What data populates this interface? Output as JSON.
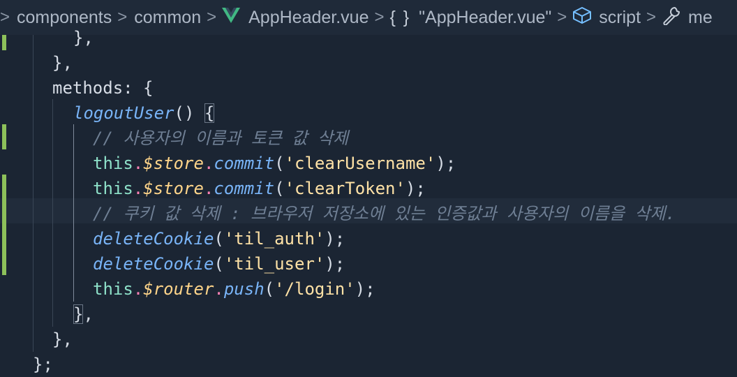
{
  "breadcrumb": {
    "items": [
      "components",
      "common",
      "AppHeader.vue",
      "\"AppHeader.vue\"",
      "script",
      "me"
    ],
    "separator": ">",
    "brace_glyph": "{ }",
    "icons": [
      "chevron-right-icon",
      "vue-logo-icon",
      "braces-icon",
      "cube-icon",
      "wrench-icon"
    ]
  },
  "code": {
    "l0_a": "},",
    "l1_a": "},",
    "l2_a": "methods: {",
    "l3_fn": "logoutUser",
    "l3_b": "() ",
    "l3_c": "{",
    "l4_cm": "// 사용자의 이름과 토큰 값 삭제",
    "l5_this": "this",
    "l5_dot1": ".",
    "l5_prop": "$store",
    "l5_dot2": ".",
    "l5_fn": "commit",
    "l5_open": "(",
    "l5_str": "'clearUsername'",
    "l5_close": ");",
    "l6_this": "this",
    "l6_dot1": ".",
    "l6_prop": "$store",
    "l6_dot2": ".",
    "l6_fn": "commit",
    "l6_open": "(",
    "l6_str": "'clearToken'",
    "l6_close": ");",
    "l7_cm": "// 쿠키 값 삭제 : 브라우저 저장소에 있는 인증값과 사용자의 이름을 삭제.",
    "l8_fn": "deleteCookie",
    "l8_open": "(",
    "l8_str": "'til_auth'",
    "l8_close": ");",
    "l9_fn": "deleteCookie",
    "l9_open": "(",
    "l9_str": "'til_user'",
    "l9_close": ");",
    "l10_this": "this",
    "l10_dot1": ".",
    "l10_prop": "$router",
    "l10_dot2": ".",
    "l10_fn": "push",
    "l10_open": "(",
    "l10_str": "'/login'",
    "l10_close": ");",
    "l11_brace": "}",
    "l11_comma": ",",
    "l12_a": "},",
    "l13_a": "};"
  },
  "colors": {
    "background": "#1b2533",
    "git_added": "#8dc15a",
    "keyword_this": "#8ee1c9",
    "property": "#ffd58a",
    "function": "#79b4f7",
    "string": "#ffe2a6",
    "comment": "#6f7f94",
    "operator_dot": "#ff82b6"
  }
}
